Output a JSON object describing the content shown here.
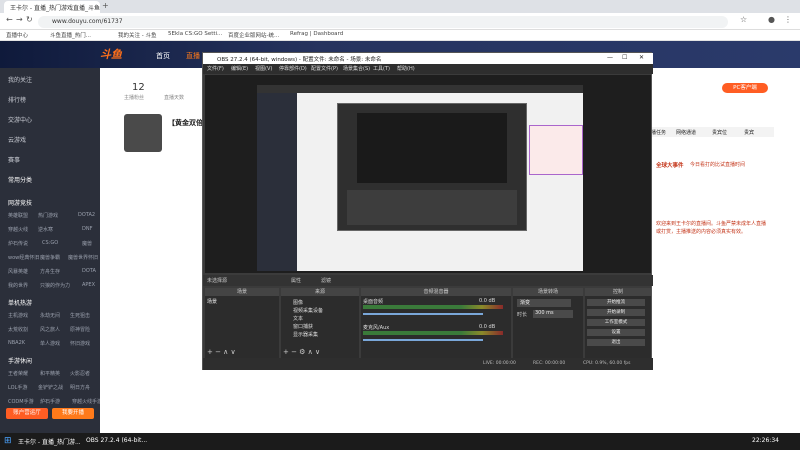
{
  "browser": {
    "tab_title": "王卡尔 - 直播_热门游戏直播_斗鱼",
    "url": "www.douyu.com/61737",
    "bookmarks": [
      "直播中心",
      "斗鱼直播_热门...",
      "我的关注 - 斗鱼",
      "5Ekla CS:GO Setti...",
      "百度企业版网站-统...",
      "Refrag | Dashboard"
    ]
  },
  "site": {
    "logo": "斗鱼",
    "nav": [
      "首页",
      "直播"
    ],
    "sidebar": [
      {
        "label": "我的关注"
      },
      {
        "label": "排行榜"
      },
      {
        "label": "交游中心"
      },
      {
        "label": "云游戏"
      },
      {
        "label": "赛事"
      }
    ],
    "sections": [
      {
        "title": "常用分类",
        "items": []
      },
      {
        "title": "网游竞技",
        "items": [
          "英雄联盟",
          "热门游戏",
          "DOTA2",
          "穿越火线",
          "逆水寒",
          "DNF",
          "炉石传说",
          "CS:GO",
          "魔兽",
          "wow经典怀旧",
          "魔兽争霸",
          "魔兽世界怀旧",
          "风暴英雄",
          "方舟生存",
          "DOTA",
          "我的世界",
          "只狼的作为力",
          "APEX"
        ]
      },
      {
        "title": "单机热游",
        "items": [
          "主机游戏",
          "永劫无间",
          "生死狙击",
          "太荒收割",
          "风之旅人",
          "原神冒险",
          "NBA2K",
          "单人游戏",
          "怀旧游戏"
        ]
      },
      {
        "title": "手游休闲",
        "items": [
          "王者荣耀",
          "和平精英",
          "火影忍者",
          "LOL手游",
          "金铲铲之战",
          "明日方舟",
          "CODM手游",
          "炉石手游",
          "穿越火线手游"
        ]
      }
    ],
    "buttons": {
      "broadcast": "账户营运厅",
      "open_live": "我要开播"
    },
    "stats": {
      "count": "12",
      "label1": "主播粉丝",
      "label2": "直播天数"
    },
    "streamer_title": "【黄金双倍】",
    "right_panel": {
      "pc_badge": "PC客户端",
      "tabs": [
        "主播任务",
        "网络通道",
        "贵宾位",
        "贵宾"
      ],
      "event_title": "全球大事件",
      "event_text": "今日看打的比试直播时间"
    },
    "room_intro": "欢迎来到王卡尔的直播间。斗鱼严禁未成年人直播或打赏，主播推送的内容必须真实有效。"
  },
  "obs": {
    "title": "OBS 27.2.4 (64-bit, windows) - 配置文件: 未命名 - 场景: 未命名",
    "menus": [
      "文件(F)",
      "编辑(E)",
      "视图(V)",
      "停靠部件(D)",
      "配置文件(P)",
      "场景集合(S)",
      "工具(T)",
      "帮助(H)"
    ],
    "scene_label": "未选择源",
    "props": "属性",
    "filters": "滤镜",
    "panels": {
      "scenes": "场景",
      "sources": "来源",
      "mixer": "音频混音器",
      "transitions": "场景转场",
      "controls": "控制"
    },
    "scene_items": [
      "场景"
    ],
    "sources": [
      "图像",
      "视频采集设备",
      "文本",
      "窗口捕获",
      "显示器采集"
    ],
    "mixer": [
      {
        "name": "桌面音频",
        "db": "0.0 dB"
      },
      {
        "name": "麦克风/Aux",
        "db": "0.0 dB"
      }
    ],
    "transition": {
      "name": "渐变",
      "duration_label": "时长",
      "duration": "300 ms"
    },
    "control_buttons": [
      "开始推流",
      "开始录制",
      "工作室模式",
      "设置",
      "退出"
    ],
    "status": {
      "live": "LIVE: 00:00:00",
      "rec": "REC: 00:00:00",
      "cpu": "CPU: 0.9%, 60.00 fps"
    }
  },
  "taskbar": {
    "items": [
      "王卡尔 - 直播_热门游...",
      "OBS 27.2.4 (64-bit..."
    ],
    "time": "22:26:34"
  }
}
